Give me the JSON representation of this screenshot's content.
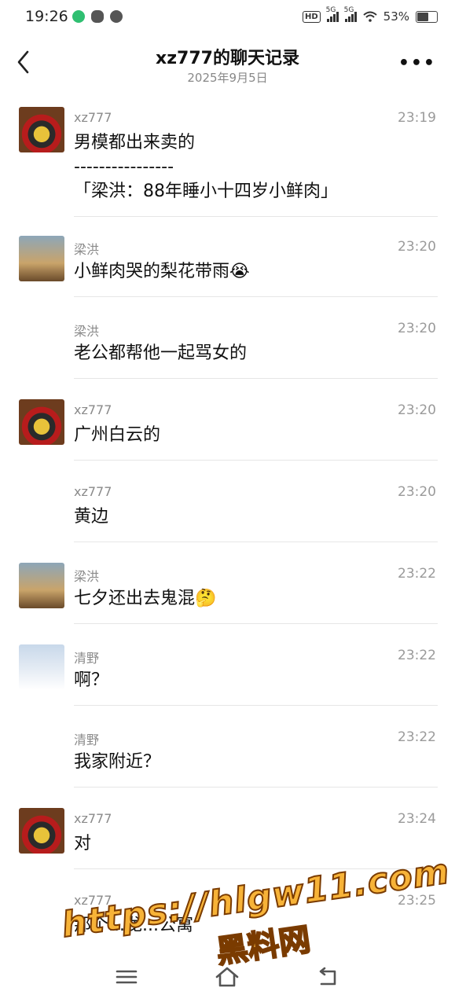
{
  "status": {
    "time": "19:26",
    "network_badge": "HD",
    "signal1_label": "5G",
    "signal2_label": "5G",
    "battery": "53%"
  },
  "header": {
    "title": "xz777的聊天记录",
    "subtitle": "2025年9月5日"
  },
  "messages": [
    {
      "name": "xz777",
      "time": "23:19",
      "text": "男模都出来卖的\n----------------\n「梁洪：88年睡小十四岁小鲜肉」",
      "avatar": "racer-helmet-avatar"
    },
    {
      "name": "梁洪",
      "time": "23:20",
      "text": "小鲜肉哭的梨花带雨😭",
      "avatar": "horse-rider-avatar"
    },
    {
      "name": "梁洪",
      "time": "23:20",
      "text": "老公都帮他一起骂女的",
      "avatar": ""
    },
    {
      "name": "xz777",
      "time": "23:20",
      "text": "广州白云的",
      "avatar": "racer-helmet-avatar"
    },
    {
      "name": "xz777",
      "time": "23:20",
      "text": "黄边",
      "avatar": ""
    },
    {
      "name": "梁洪",
      "time": "23:22",
      "text": "七夕还出去鬼混🤔",
      "avatar": "horse-rider-avatar"
    },
    {
      "name": "清野",
      "time": "23:22",
      "text": "啊？",
      "avatar": "snow-rider-avatar"
    },
    {
      "name": "清野",
      "time": "23:22",
      "text": "我家附近？",
      "avatar": ""
    },
    {
      "name": "xz777",
      "time": "23:24",
      "text": "对",
      "avatar": "racer-helmet-avatar"
    },
    {
      "name": "xz777",
      "time": "23:25",
      "text": "那个...龙...公寓",
      "avatar": ""
    }
  ],
  "watermark": {
    "url": "https://hlgw11.com",
    "brand": "黑料网"
  },
  "colors": {
    "accent_watermark": "#f7b338",
    "divider": "#e6e6e6",
    "meta_text": "#8a8a8a"
  }
}
